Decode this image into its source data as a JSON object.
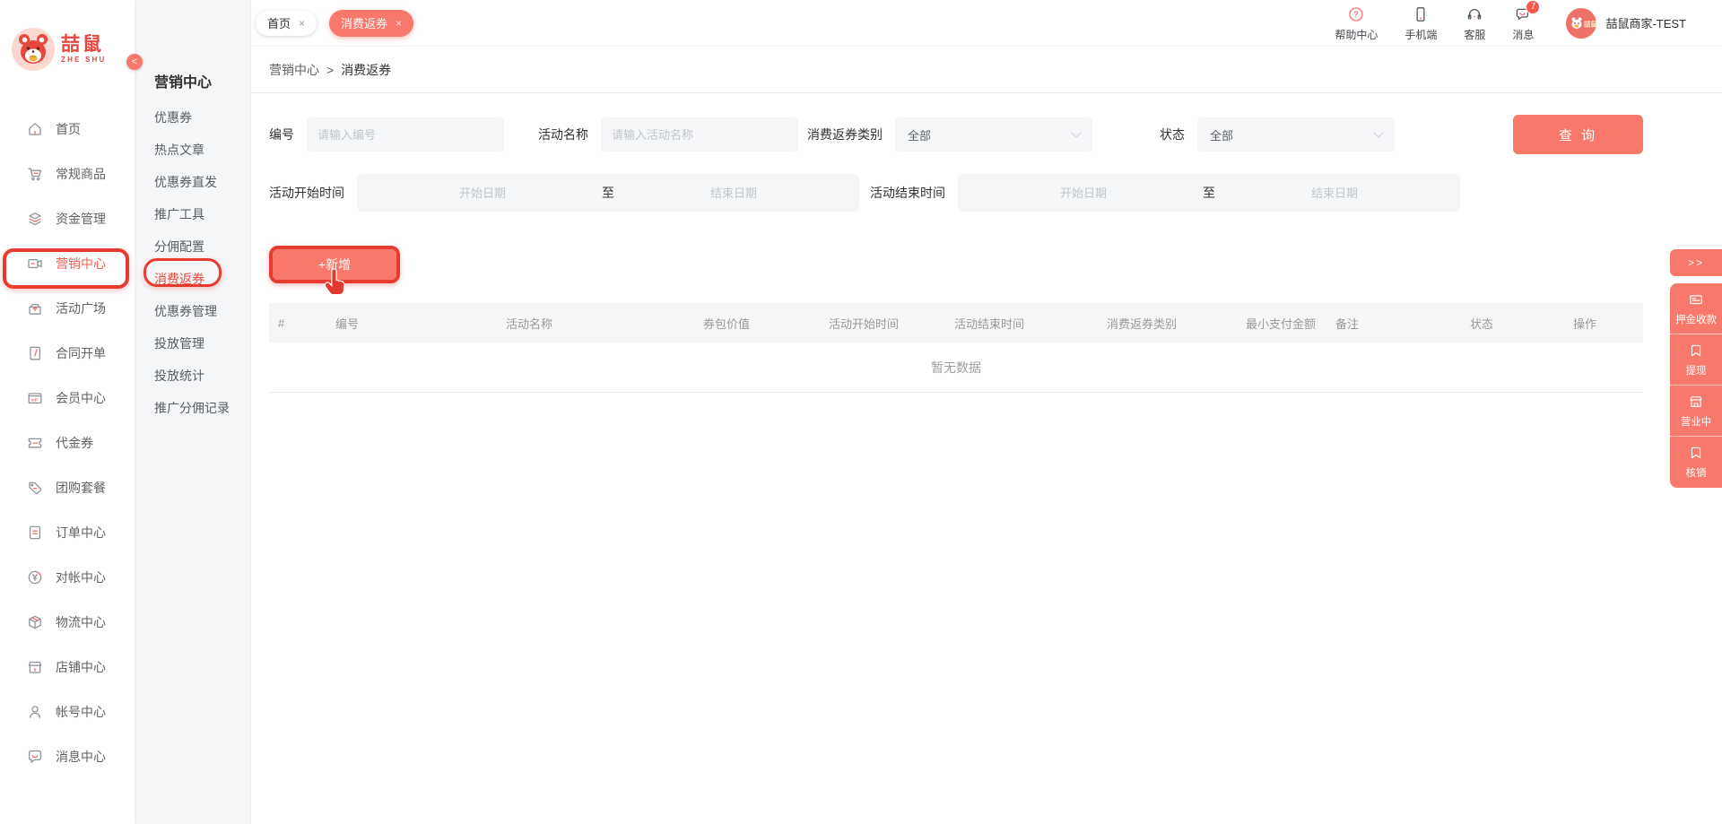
{
  "brand": {
    "logo_cn": "喆鼠",
    "logo_en": "ZHE SHU",
    "collapse": "<",
    "merchant": "喆鼠商家-TEST"
  },
  "colors": {
    "primary": "#f8796b",
    "annotation": "#e63c30",
    "active_text": "#f25f55",
    "badge": "#f5594e"
  },
  "sidebar": {
    "items": [
      {
        "label": "首页",
        "icon": "home-icon"
      },
      {
        "label": "常规商品",
        "icon": "cart-icon"
      },
      {
        "label": "资金管理",
        "icon": "funds-icon"
      },
      {
        "label": "营销中心",
        "icon": "marketing-icon",
        "active": true,
        "annotated": true
      },
      {
        "label": "活动广场",
        "icon": "activity-icon"
      },
      {
        "label": "合同开单",
        "icon": "contract-icon"
      },
      {
        "label": "会员中心",
        "icon": "member-icon"
      },
      {
        "label": "代金券",
        "icon": "voucher-icon"
      },
      {
        "label": "团购套餐",
        "icon": "groupbuy-icon"
      },
      {
        "label": "订单中心",
        "icon": "order-icon"
      },
      {
        "label": "对帐中心",
        "icon": "reconcile-icon"
      },
      {
        "label": "物流中心",
        "icon": "logistics-icon"
      },
      {
        "label": "店铺中心",
        "icon": "store-icon"
      },
      {
        "label": "帐号中心",
        "icon": "account-icon"
      },
      {
        "label": "消息中心",
        "icon": "message-center-icon"
      }
    ]
  },
  "submenu": {
    "title": "营销中心",
    "items": [
      {
        "label": "优惠券"
      },
      {
        "label": "热点文章"
      },
      {
        "label": "优惠券直发"
      },
      {
        "label": "推广工具"
      },
      {
        "label": "分佣配置"
      },
      {
        "label": "消费返券",
        "active": true,
        "annotated": true
      },
      {
        "label": "优惠券管理"
      },
      {
        "label": "投放管理"
      },
      {
        "label": "投放统计"
      },
      {
        "label": "推广分佣记录"
      }
    ]
  },
  "tabs": [
    {
      "label": "首页",
      "close": "×",
      "active": false
    },
    {
      "label": "消费返券",
      "close": "×",
      "active": true
    }
  ],
  "topbar": {
    "help": "帮助中心",
    "mobile": "手机端",
    "service": "客服",
    "message": "消息",
    "message_badge": "7"
  },
  "breadcrumb": {
    "parent": "营销中心",
    "separator": ">",
    "current": "消费返券"
  },
  "filters": {
    "no_label": "编号",
    "no_placeholder": "请输入编号",
    "name_label": "活动名称",
    "name_placeholder": "请输入活动名称",
    "type_label": "消费返券类别",
    "type_value": "全部",
    "status_label": "状态",
    "status_value": "全部",
    "search": "查 询",
    "start_label": "活动开始时间",
    "end_label": "活动结束时间",
    "date_start_placeholder": "开始日期",
    "date_to": "至",
    "date_end_placeholder": "结束日期"
  },
  "toolbar": {
    "add": "+新增"
  },
  "table": {
    "columns": [
      "#",
      "编号",
      "活动名称",
      "券包价值",
      "活动开始时间",
      "活动结束时间",
      "消费返券类别",
      "最小支付金额",
      "备注",
      "状态",
      "操作"
    ],
    "empty": "暂无数据",
    "rows": []
  },
  "rail": {
    "expand": ">>",
    "buttons": [
      {
        "label": "押金收款",
        "icon": "card-icon"
      },
      {
        "label": "提现",
        "icon": "withdraw-icon"
      },
      {
        "label": "营业中",
        "icon": "shop-status-icon"
      },
      {
        "label": "核销",
        "icon": "verify-icon"
      }
    ]
  }
}
